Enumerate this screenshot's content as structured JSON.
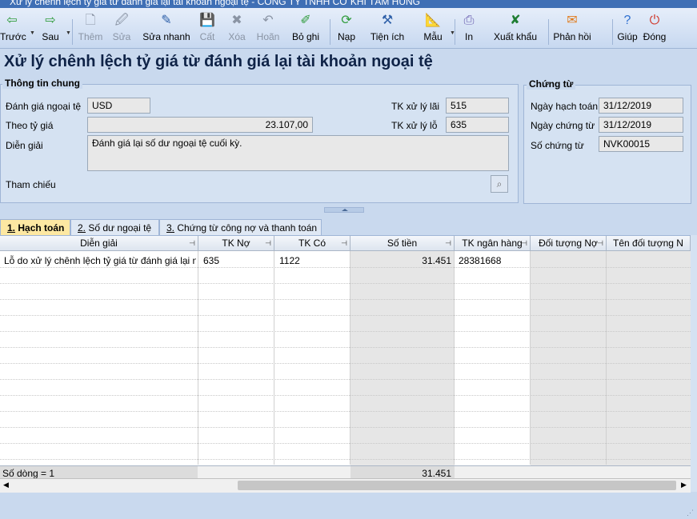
{
  "window": {
    "title": "Xử lý chênh lệch tỷ giá từ đánh giá lại tài khoản ngoại tệ - CÔNG TY TNHH CƠ KHÍ TÂM HÙNG"
  },
  "toolbar": {
    "items": [
      {
        "label": "Trước",
        "icon": "arrow-left-icon",
        "glyph": "⇦",
        "color": "#2e9b3a",
        "enabled": true
      },
      {
        "label": "Sau",
        "icon": "arrow-right-icon",
        "glyph": "⇨",
        "color": "#2e9b3a",
        "enabled": true
      },
      {
        "label": "Thêm",
        "icon": "new-document-icon",
        "glyph": "🗋",
        "color": "#8a94a4",
        "enabled": false
      },
      {
        "label": "Sửa",
        "icon": "edit-document-icon",
        "glyph": "🖉",
        "color": "#8a94a4",
        "enabled": false
      },
      {
        "label": "Sửa nhanh",
        "icon": "quick-edit-icon",
        "glyph": "✎",
        "color": "#2d5fa8",
        "enabled": true
      },
      {
        "label": "Cất",
        "icon": "save-icon",
        "glyph": "💾",
        "color": "#8a94a4",
        "enabled": false
      },
      {
        "label": "Xóa",
        "icon": "delete-icon",
        "glyph": "✖",
        "color": "#8a94a4",
        "enabled": false
      },
      {
        "label": "Hoãn",
        "icon": "undo-icon",
        "glyph": "↶",
        "color": "#8a94a4",
        "enabled": false
      },
      {
        "label": "Bỏ ghi",
        "icon": "unpost-icon",
        "glyph": "✐",
        "color": "#2e9b3a",
        "enabled": true
      },
      {
        "label": "Nạp",
        "icon": "refresh-icon",
        "glyph": "⟳",
        "color": "#2e9b3a",
        "enabled": true
      },
      {
        "label": "Tiện ích",
        "icon": "utilities-icon",
        "glyph": "⚒",
        "color": "#2d5fa8",
        "enabled": true
      },
      {
        "label": "Mẫu",
        "icon": "template-icon",
        "glyph": "📐",
        "color": "#c08a1a",
        "enabled": true
      },
      {
        "label": "In",
        "icon": "print-icon",
        "glyph": "⎙",
        "color": "#6a5fb0",
        "enabled": true
      },
      {
        "label": "Xuất khẩu",
        "icon": "excel-export-icon",
        "glyph": "✘",
        "color": "#1e7d32",
        "enabled": true
      },
      {
        "label": "Phản hồi",
        "icon": "feedback-mail-icon",
        "glyph": "✉",
        "color": "#e07a1a",
        "enabled": true
      },
      {
        "label": "Giúp",
        "icon": "help-icon",
        "glyph": "?",
        "color": "#2d6fd0",
        "enabled": true
      },
      {
        "label": "Đóng",
        "icon": "close-icon",
        "glyph": "⏻",
        "color": "#d0392b",
        "enabled": true
      }
    ]
  },
  "page": {
    "title": "Xử lý chênh lệch tỷ giá từ đánh giá lại tài khoản ngoại tệ"
  },
  "general": {
    "title": "Thông tin chung",
    "currency_label": "Đánh giá ngoại tệ",
    "currency_value": "USD",
    "rate_label": "Theo tỷ giá",
    "rate_value": "23.107,00",
    "desc_label": "Diễn giải",
    "desc_value": "Đánh giá lại số dư ngoại tệ cuối kỳ.",
    "ref_label": "Tham chiếu",
    "gain_label": "TK xử lý lãi",
    "gain_value": "515",
    "loss_label": "TK xử lý lỗ",
    "loss_value": "635"
  },
  "voucher": {
    "title": "Chứng từ",
    "posting_date_label": "Ngày hạch toán",
    "posting_date_value": "31/12/2019",
    "voucher_date_label": "Ngày chứng từ",
    "voucher_date_value": "31/12/2019",
    "voucher_no_label": "Số chứng từ",
    "voucher_no_value": "NVK00015"
  },
  "tabs": [
    {
      "key": "1.",
      "label": " Hạch toán",
      "active": true
    },
    {
      "key": "2.",
      "label": " Số dư ngoại tệ",
      "active": false
    },
    {
      "key": "3.",
      "label": " Chứng từ công nợ và thanh toán",
      "active": false
    }
  ],
  "grid": {
    "columns": [
      "Diễn giải",
      "TK Nợ",
      "TK Có",
      "Số tiền",
      "TK ngân hàng",
      "Đối tượng Nợ",
      "Tên đối tượng N"
    ],
    "rows": [
      {
        "desc": "Lỗ do xử lý chênh lệch tỷ giá từ đánh giá lại ngo",
        "debit": "635",
        "credit": "1122",
        "amount": "31.451",
        "bank": "28381668",
        "debtor": "",
        "debtor_name": ""
      }
    ],
    "footer_count": "Số dòng = 1",
    "footer_total": "31.451"
  }
}
